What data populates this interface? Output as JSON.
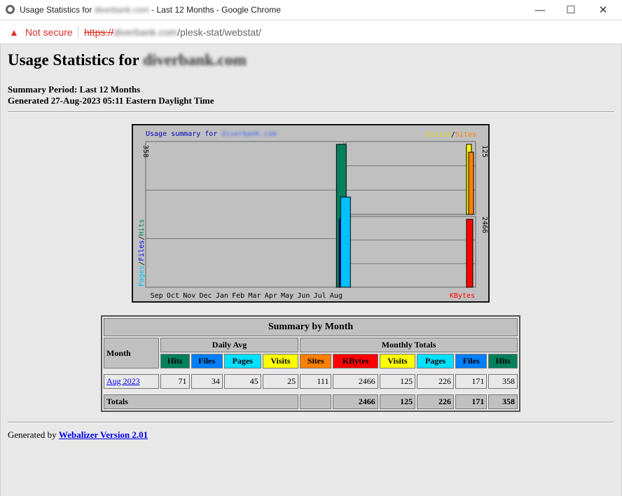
{
  "window": {
    "title_prefix": "Usage Statistics for",
    "title_domain": "diverbank.com",
    "title_suffix": "- Last 12 Months - Google Chrome",
    "minimize": "—",
    "maximize": "☐",
    "close": "✕"
  },
  "address": {
    "warning_icon": "▲",
    "not_secure": "Not secure",
    "scheme": "https://",
    "host": "diverbank.com",
    "path": "/plesk-stat/webstat/"
  },
  "page": {
    "heading": "Usage Statistics for",
    "heading_domain": "diverbank.com",
    "summary_period": "Summary Period: Last 12 Months",
    "generated": "Generated 27-Aug-2023 05:11 Eastern Daylight Time"
  },
  "chart_data": {
    "type": "bar",
    "title": "Usage summary for",
    "title_domain": "diverbank.com",
    "categories": [
      "Sep",
      "Oct",
      "Nov",
      "Dec",
      "Jan",
      "Feb",
      "Mar",
      "Apr",
      "May",
      "Jun",
      "Jul",
      "Aug"
    ],
    "left_axis_label": [
      "Pages",
      "Files",
      "Hits"
    ],
    "left_max": 358,
    "series_left": [
      {
        "name": "Hits",
        "color": "#00805c",
        "values": [
          0,
          0,
          0,
          0,
          0,
          0,
          0,
          0,
          0,
          0,
          0,
          358
        ]
      },
      {
        "name": "Files",
        "color": "#0000ff",
        "values": [
          0,
          0,
          0,
          0,
          0,
          0,
          0,
          0,
          0,
          0,
          0,
          171
        ]
      },
      {
        "name": "Pages",
        "color": "#00c0ff",
        "values": [
          0,
          0,
          0,
          0,
          0,
          0,
          0,
          0,
          0,
          0,
          0,
          226
        ]
      }
    ],
    "upper_right_label": [
      "Visits",
      "Sites"
    ],
    "upper_right_max": 125,
    "series_upper_right": [
      {
        "name": "Visits",
        "color": "#ffff00",
        "values": [
          0,
          0,
          0,
          0,
          0,
          0,
          0,
          0,
          0,
          0,
          0,
          125
        ]
      },
      {
        "name": "Sites",
        "color": "#ff8000",
        "values": [
          0,
          0,
          0,
          0,
          0,
          0,
          0,
          0,
          0,
          0,
          0,
          111
        ]
      }
    ],
    "lower_right_label": "KBytes",
    "lower_right_max": 2466,
    "series_lower_right": [
      {
        "name": "KBytes",
        "color": "#ff0000",
        "values": [
          0,
          0,
          0,
          0,
          0,
          0,
          0,
          0,
          0,
          0,
          0,
          2466
        ]
      }
    ]
  },
  "table": {
    "title": "Summary by Month",
    "month_header": "Month",
    "daily_avg": "Daily Avg",
    "monthly_totals": "Monthly Totals",
    "col_hits": "Hits",
    "col_files": "Files",
    "col_pages": "Pages",
    "col_visits": "Visits",
    "col_sites": "Sites",
    "col_kbytes": "KBytes",
    "colors": {
      "hits": "#00805c",
      "files": "#0080ff",
      "pages": "#00e0ff",
      "visits": "#ffff00",
      "sites": "#ff8000",
      "kbytes": "#ff0000"
    },
    "row": {
      "month": "Aug 2023",
      "avg_hits": "71",
      "avg_files": "34",
      "avg_pages": "45",
      "avg_visits": "25",
      "sites": "111",
      "kbytes": "2466",
      "visits": "125",
      "pages": "226",
      "files": "171",
      "hits": "358"
    },
    "totals": {
      "label": "Totals",
      "kbytes": "2466",
      "visits": "125",
      "pages": "226",
      "files": "171",
      "hits": "358"
    }
  },
  "footer": {
    "text": "Generated by",
    "link": "Webalizer Version 2.01"
  }
}
